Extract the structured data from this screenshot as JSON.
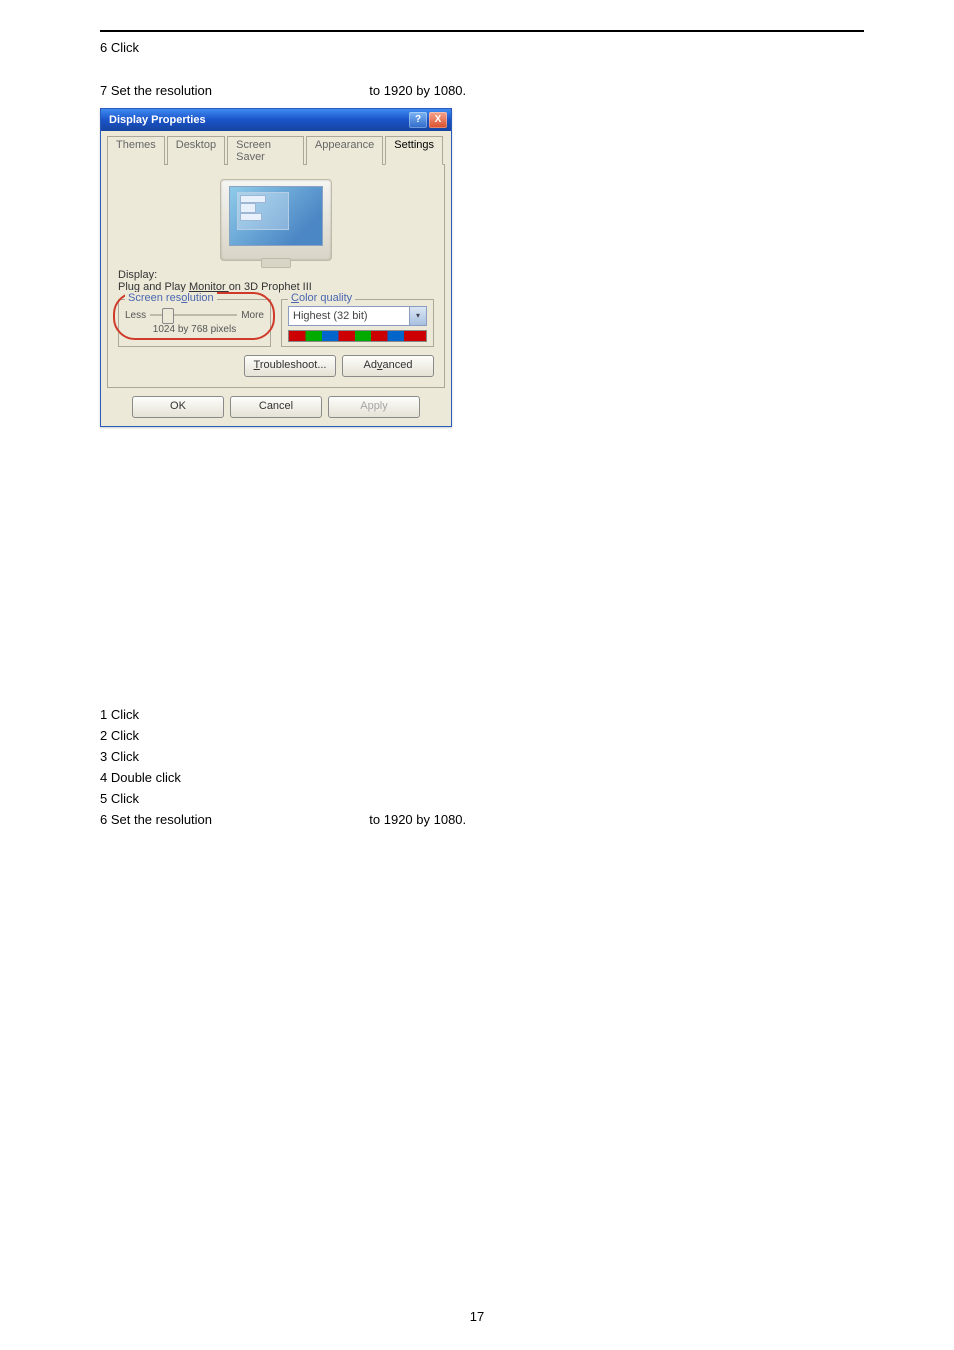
{
  "page_number": "17",
  "upper_steps": {
    "step6": "6 Click",
    "step7_prefix": "7 Set the resolution",
    "step7_suffix": "to 1920 by 1080."
  },
  "dialog": {
    "title": "Display Properties",
    "help": "?",
    "close": "X",
    "tabs": {
      "themes": "Themes",
      "desktop": "Desktop",
      "screensaver": "Screen Saver",
      "appearance": "Appearance",
      "settings": "Settings"
    },
    "display_label": "Display:",
    "display_value_pre": "Plug and Play ",
    "display_value_link": "Monitor ",
    "display_value_post": "on 3D Prophet III",
    "resolution": {
      "legend_prefix": "Screen res",
      "legend_underlined": "o",
      "legend_suffix": "lution",
      "less": "Less",
      "more": "More",
      "value": "1024 by 768 pixels"
    },
    "colorquality": {
      "legend_underlined": "C",
      "legend_suffix": "olor quality",
      "value": "Highest (32 bit)"
    },
    "buttons": {
      "troubleshoot_u": "T",
      "troubleshoot_rest": "roubleshoot...",
      "advanced_pre": "Ad",
      "advanced_u": "v",
      "advanced_post": "anced",
      "ok": "OK",
      "cancel": "Cancel",
      "apply": "Apply"
    }
  },
  "lower_steps": {
    "s1": "1 Click",
    "s2": "2 Click",
    "s3": "3 Click",
    "s4": "4 Double click",
    "s5": "5 Click",
    "s6_prefix": "6 Set the resolution",
    "s6_suffix": "to 1920 by 1080."
  }
}
